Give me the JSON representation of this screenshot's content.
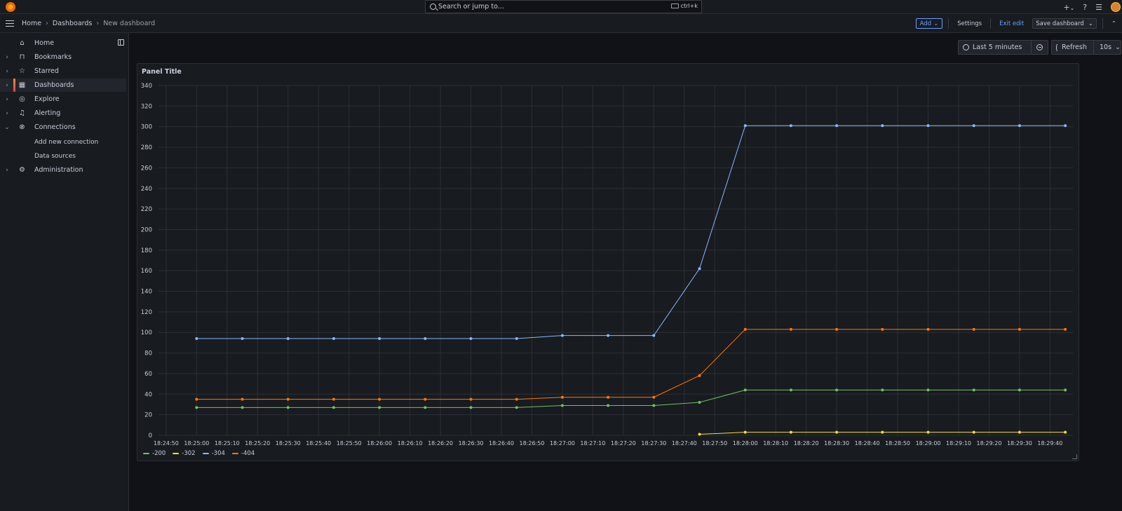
{
  "topbar": {
    "search_placeholder": "Search or jump to...",
    "shortcut": "ctrl+k",
    "plus": "+",
    "caret": "⌄",
    "help": "?",
    "news": "☰"
  },
  "navbar": {
    "breadcrumbs": [
      "Home",
      "Dashboards",
      "New dashboard"
    ],
    "sep": "›",
    "add_label": "Add",
    "settings_label": "Settings",
    "exit_edit_label": "Exit edit",
    "save_label": "Save dashboard",
    "caret": "⌄",
    "collapse": "⌃"
  },
  "sidebar": {
    "items": [
      {
        "label": "Home",
        "icon": "⌂",
        "chev": ""
      },
      {
        "label": "Bookmarks",
        "icon": "⊓",
        "chev": "›"
      },
      {
        "label": "Starred",
        "icon": "☆",
        "chev": "›"
      },
      {
        "label": "Dashboards",
        "icon": "▦",
        "chev": "›"
      },
      {
        "label": "Explore",
        "icon": "◎",
        "chev": "›"
      },
      {
        "label": "Alerting",
        "icon": "♫",
        "chev": "›"
      },
      {
        "label": "Connections",
        "icon": "⊗",
        "chev": "⌄"
      },
      {
        "label": "Administration",
        "icon": "⚙",
        "chev": "›"
      }
    ],
    "sub_items": [
      "Add new connection",
      "Data sources"
    ]
  },
  "timepicker": {
    "range_label": "Last 5 minutes",
    "refresh_label": "Refresh",
    "interval": "10s",
    "caret": "⌄"
  },
  "panel": {
    "title": "Panel Title"
  },
  "colors": {
    "s200": "#73bf69",
    "s302": "#fade2a",
    "s304": "#8ab8ff",
    "s404": "#ff780a"
  },
  "chart_data": {
    "type": "line",
    "title": "Panel Title",
    "ylim": [
      0,
      340
    ],
    "yticks": [
      0,
      20,
      40,
      60,
      80,
      100,
      120,
      140,
      160,
      180,
      200,
      220,
      240,
      260,
      280,
      300,
      320,
      340
    ],
    "x_ticks": [
      "18:24:50",
      "18:25:00",
      "18:25:10",
      "18:25:20",
      "18:25:30",
      "18:25:40",
      "18:25:50",
      "18:26:00",
      "18:26:10",
      "18:26:20",
      "18:26:30",
      "18:26:40",
      "18:26:50",
      "18:27:00",
      "18:27:10",
      "18:27:20",
      "18:27:30",
      "18:27:40",
      "18:27:50",
      "18:28:00",
      "18:28:10",
      "18:28:20",
      "18:28:30",
      "18:28:40",
      "18:28:50",
      "18:29:00",
      "18:29:10",
      "18:29:20",
      "18:29:30",
      "18:29:40"
    ],
    "x_points": [
      "18:25:00",
      "18:25:15",
      "18:25:30",
      "18:25:45",
      "18:26:00",
      "18:26:15",
      "18:26:30",
      "18:26:45",
      "18:27:00",
      "18:27:15",
      "18:27:30",
      "18:27:45",
      "18:28:00",
      "18:28:15",
      "18:28:30",
      "18:28:45",
      "18:29:00",
      "18:29:15",
      "18:29:30",
      "18:29:45"
    ],
    "grid": true,
    "legend": "bottom-left",
    "series": [
      {
        "name": "-200",
        "color": "#73bf69",
        "values": [
          27,
          27,
          27,
          27,
          27,
          27,
          27,
          27,
          29,
          29,
          29,
          32,
          44,
          44,
          44,
          44,
          44,
          44,
          44,
          44
        ]
      },
      {
        "name": "-302",
        "color": "#fade2a",
        "values": [
          null,
          null,
          null,
          null,
          null,
          null,
          null,
          null,
          null,
          null,
          null,
          1,
          3,
          3,
          3,
          3,
          3,
          3,
          3,
          3
        ]
      },
      {
        "name": "-304",
        "color": "#8ab8ff",
        "values": [
          94,
          94,
          94,
          94,
          94,
          94,
          94,
          94,
          97,
          97,
          97,
          162,
          301,
          301,
          301,
          301,
          301,
          301,
          301,
          301
        ]
      },
      {
        "name": "-404",
        "color": "#ff780a",
        "values": [
          35,
          35,
          35,
          35,
          35,
          35,
          35,
          35,
          37,
          37,
          37,
          58,
          103,
          103,
          103,
          103,
          103,
          103,
          103,
          103
        ]
      }
    ]
  }
}
